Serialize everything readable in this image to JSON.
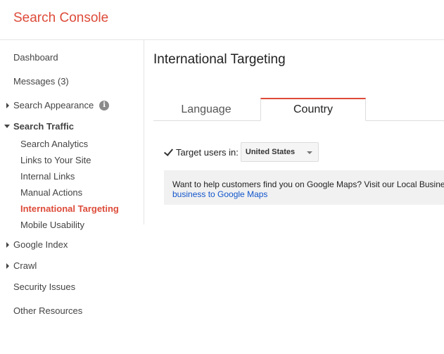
{
  "header": {
    "brand": "Search Console"
  },
  "sidebar": {
    "items": [
      {
        "label": "Dashboard"
      },
      {
        "label": "Messages (3)"
      },
      {
        "label": "Search Appearance"
      },
      {
        "label": "Search Traffic"
      },
      {
        "label": "Search Analytics"
      },
      {
        "label": "Links to Your Site"
      },
      {
        "label": "Internal Links"
      },
      {
        "label": "Manual Actions"
      },
      {
        "label": "International Targeting"
      },
      {
        "label": "Mobile Usability"
      },
      {
        "label": "Google Index"
      },
      {
        "label": "Crawl"
      },
      {
        "label": "Security Issues"
      },
      {
        "label": "Other Resources"
      }
    ],
    "info_glyph": "i"
  },
  "main": {
    "title": "International Targeting",
    "tabs": [
      {
        "label": "Language"
      },
      {
        "label": "Country"
      }
    ],
    "target": {
      "label": "Target users in:",
      "checked": true,
      "selected_country": "United States"
    },
    "notice": {
      "text": "Want to help customers find you on Google Maps? Visit our Local Business",
      "link": "business to Google Maps"
    }
  },
  "colors": {
    "brand": "#dd4b39",
    "link": "#1155cc",
    "active": "#dd4b39"
  },
  "icons": [
    "info-icon",
    "expand-arrow-icon",
    "collapse-arrow-icon",
    "checkmark-icon",
    "dropdown-caret-icon"
  ]
}
